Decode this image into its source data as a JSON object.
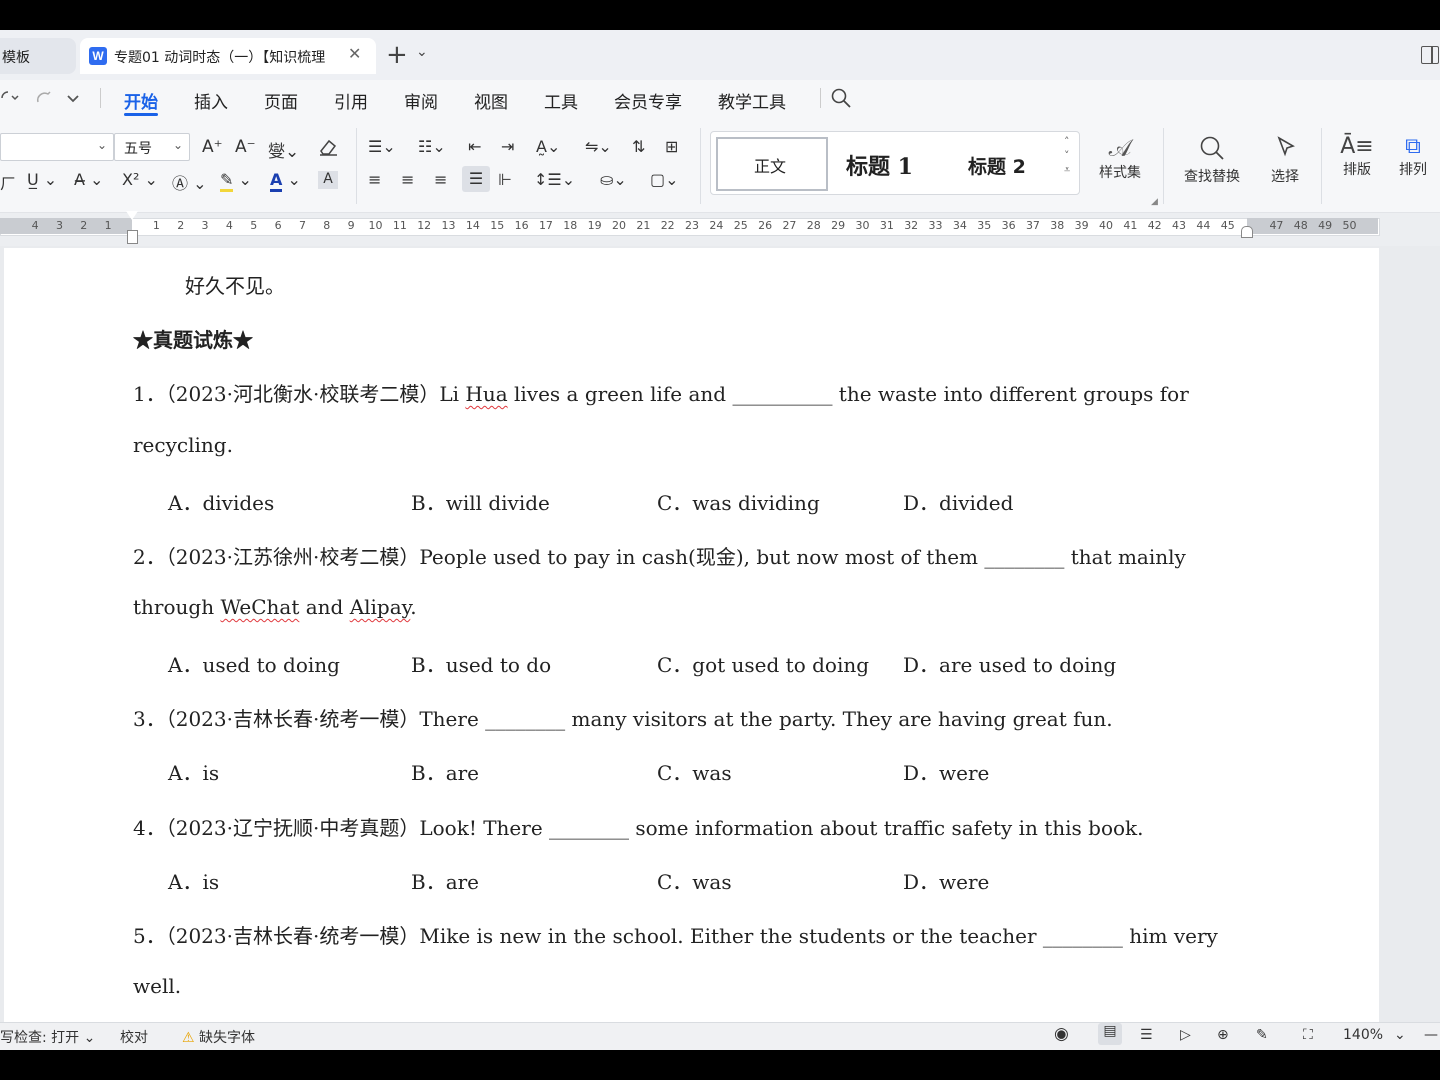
{
  "tabs": {
    "prev_label": "模板",
    "active_label": "专题01 动词时态（一）【知识梳理",
    "logo": "W",
    "close": "✕",
    "new_tab": "+",
    "dropdown": "⌄"
  },
  "menu": {
    "items": [
      "开始",
      "插入",
      "页面",
      "引用",
      "审阅",
      "视图",
      "工具",
      "会员专享",
      "教学工具"
    ]
  },
  "toolbar": {
    "font_size": "五号",
    "styles": {
      "normal": "正文",
      "h1": "标题 1",
      "h2": "标题 2"
    },
    "style_set_label": "样式集",
    "find_replace_label": "查找替换",
    "select_label": "选择",
    "layout_label": "排版",
    "arrange_label": "排列",
    "accent_color": "#1a62e8"
  },
  "ruler": {
    "left_ticks": [
      "4",
      "3",
      "2",
      "1"
    ],
    "right_ticks": [
      "1",
      "2",
      "3",
      "4",
      "5",
      "6",
      "7",
      "8",
      "9",
      "10",
      "11",
      "12",
      "13",
      "14",
      "15",
      "16",
      "17",
      "18",
      "19",
      "20",
      "21",
      "22",
      "23",
      "24",
      "25",
      "26",
      "27",
      "28",
      "29",
      "30",
      "31",
      "32",
      "33",
      "34",
      "35",
      "36",
      "37",
      "38",
      "39",
      "40",
      "41",
      "42",
      "43",
      "44",
      "45",
      "47",
      "48",
      "49",
      "50"
    ]
  },
  "document": {
    "line0": "好久不见。",
    "section_title": "★真题试炼★",
    "q1": {
      "lead": "1．（2023·河北衡水·校联考二模）Li ",
      "hua": "Hua",
      "rest": " lives a green life and __________ the waste into different groups for",
      "cont": "recycling.",
      "options": [
        "A．divides",
        "B．will divide",
        "C．was dividing",
        "D．divided"
      ]
    },
    "q2": {
      "line1": "2．（2023·江苏徐州·校考二模）People used to pay in cash(现金), but now most of them ________ that mainly",
      "cont_a": "through ",
      "wechat": "WeChat",
      "cont_b": " and ",
      "alipay": "Alipay",
      "cont_c": ".",
      "options": [
        "A．used to doing",
        "B．used to do",
        "C．got used to doing",
        "D．are used to doing"
      ]
    },
    "q3": {
      "line1": "3．（2023·吉林长春·统考一模）There ________ many visitors at the party. They are having great fun.",
      "options": [
        "A．is",
        "B．are",
        "C．was",
        "D．were"
      ]
    },
    "q4": {
      "line1": "4．（2023·辽宁抚顺·中考真题）Look! There ________ some information about traffic safety in this book.",
      "options": [
        "A．is",
        "B．are",
        "C．was",
        "D．were"
      ]
    },
    "q5": {
      "line1": "5．（2023·吉林长春·统考一模）Mike is new in the school. Either the students or the teacher ________ him very",
      "cont": "well."
    }
  },
  "status": {
    "spell_check": "写检查: 打开",
    "proofread": "校对",
    "missing_font": "缺失字体",
    "zoom": "140%"
  }
}
